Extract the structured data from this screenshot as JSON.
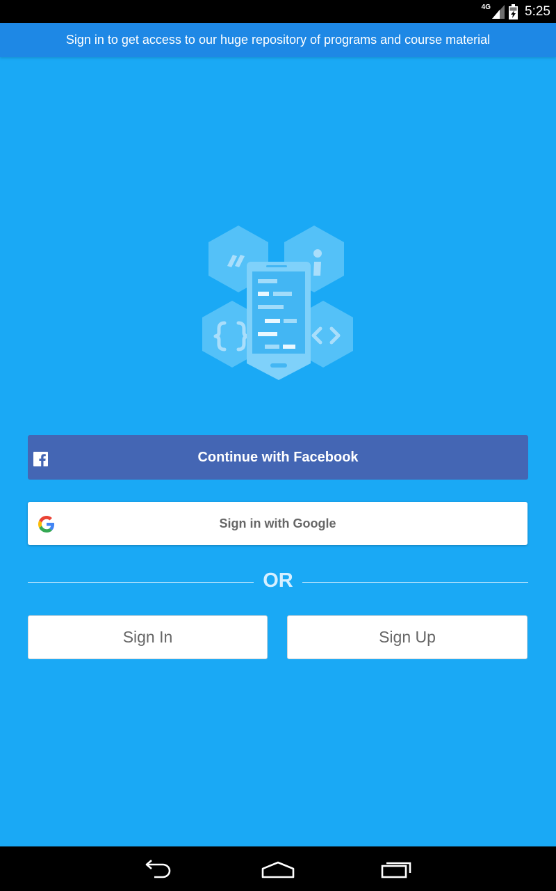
{
  "status_bar": {
    "network_label": "4G",
    "time": "5:25",
    "icons": [
      "signal-icon",
      "battery-icon"
    ]
  },
  "banner": {
    "text": "Sign in to get access to our huge repository of programs and course material"
  },
  "logo": {
    "icon": "app-logo-hexagon-phone-icon",
    "colors": {
      "hex": "#54c1f8",
      "phone_frame": "#7fd1fa",
      "phone_screen": "#43b6f3",
      "code_lines": "#c8ebfd"
    }
  },
  "auth": {
    "facebook_label": "Continue with Facebook",
    "facebook_icon": "facebook-icon",
    "google_label": "Sign in with Google",
    "google_icon": "google-g-icon",
    "or_label": "OR",
    "sign_in_label": "Sign In",
    "sign_up_label": "Sign Up"
  },
  "nav_bar": {
    "items": [
      "back-icon",
      "home-icon",
      "recent-apps-icon"
    ]
  },
  "colors": {
    "background": "#1aa9f5",
    "banner": "#1e88e5",
    "facebook": "#4466b4",
    "button_text": "#666666",
    "or_text": "#d6efff"
  }
}
